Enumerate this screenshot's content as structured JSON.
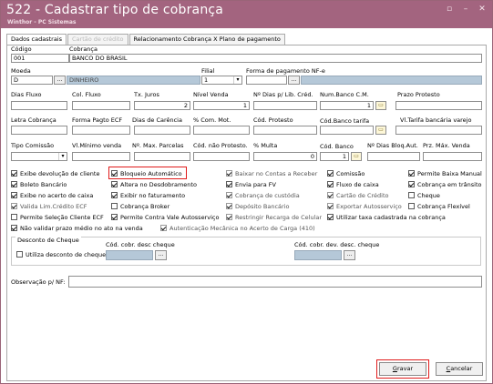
{
  "window": {
    "title": "522 - Cadastrar tipo de cobrança",
    "subtitle": "Winthor - PC Sistemas",
    "controls": {
      "minimize": "▫",
      "restore": "–",
      "close": "✕"
    }
  },
  "tabs": [
    {
      "label": "Dados cadastrais"
    },
    {
      "label": "Cartão de crédito"
    },
    {
      "label": "Relacionamento Cobrança X Plano de pagamento"
    }
  ],
  "fields": {
    "codigo": {
      "label": "Código",
      "value": "001"
    },
    "cobranca": {
      "label": "Cobrança",
      "value": "BANCO DO BRASIL"
    },
    "moeda": {
      "label": "Moeda",
      "value": "D",
      "dots": "...",
      "desc": "DINHEIRO"
    },
    "filial": {
      "label": "Filial",
      "value": "1"
    },
    "forma_pagamento": {
      "label": "Forma de pagamento NF-e",
      "dots": "..."
    },
    "dias_fluxo": {
      "label": "Dias Fluxo",
      "value": ""
    },
    "col_fluxo": {
      "label": "Col. Fluxo",
      "value": ""
    },
    "tx_juros": {
      "label": "Tx. Juros",
      "value": "2"
    },
    "nivel_venda": {
      "label": "Nível Venda",
      "value": "1"
    },
    "num_dias_lib": {
      "label": "Nº Dias p/ Lib. Créd.",
      "value": ""
    },
    "num_banco_cm": {
      "label": "Num.Banco C.M.",
      "value": "1"
    },
    "prazo_protesto": {
      "label": "Prazo Protesto",
      "value": ""
    },
    "letra_cobranca": {
      "label": "Letra Cobrança",
      "value": ""
    },
    "forma_pagto_ecf": {
      "label": "Forma Pagto ECF",
      "value": ""
    },
    "dias_carencia": {
      "label": "Dias de Carência",
      "value": ""
    },
    "com_mot": {
      "label": "% Com. Mot.",
      "value": ""
    },
    "cod_protesto": {
      "label": "Cód. Protesto",
      "value": ""
    },
    "cod_banco_tarifa": {
      "label": "Cód.Banco tarifa",
      "value": ""
    },
    "vl_tarifa": {
      "label": "Vl.Tarifa bancária varejo",
      "value": ""
    },
    "tipo_comissao": {
      "label": "Tipo Comissão",
      "value": ""
    },
    "vl_minimo_venda": {
      "label": "Vl.Mínimo venda",
      "value": ""
    },
    "max_parcelas": {
      "label": "Nº. Max. Parcelas",
      "value": ""
    },
    "cod_nao_protesto": {
      "label": "Cód. não Protesto.",
      "value": ""
    },
    "multa": {
      "label": "% Multa",
      "value": "0"
    },
    "cod_banco": {
      "label": "Cód. Banco",
      "value": "1"
    },
    "dias_bloq_aut": {
      "label": "Nº Dias Bloq.Aut.",
      "value": ""
    },
    "prz_max_venda": {
      "label": "Prz. Máx. Venda",
      "value": ""
    }
  },
  "checkboxes": [
    {
      "label": "Exibe devolução de cliente",
      "checked": true
    },
    {
      "label": "Bloqueio Automático",
      "checked": true
    },
    {
      "label": "Baixar no Contas a Receber",
      "checked": true
    },
    {
      "label": "Comissão",
      "checked": true
    },
    {
      "label": "Permite Baixa Manual",
      "checked": true
    },
    {
      "label": "Boleto Bancário",
      "checked": true
    },
    {
      "label": "Altera no Desdobramento",
      "checked": true
    },
    {
      "label": "Envia para FV",
      "checked": true
    },
    {
      "label": "Fluxo de caixa",
      "checked": true
    },
    {
      "label": "Cobrança em trânsito",
      "checked": true
    },
    {
      "label": "Exibe no acerto de caixa",
      "checked": true
    },
    {
      "label": "Exibir no faturamento",
      "checked": true
    },
    {
      "label": "Cobrança de custódia",
      "checked": true
    },
    {
      "label": "Cartão de Crédito",
      "checked": true
    },
    {
      "label": "Cheque",
      "checked": false
    },
    {
      "label": "Valida Lim.Crédito ECF",
      "checked": true
    },
    {
      "label": "Cobrança Broker",
      "checked": false
    },
    {
      "label": "Depósito Bancário",
      "checked": true
    },
    {
      "label": "Exportar Autosserviço",
      "checked": true
    },
    {
      "label": "Cobrança Flexível",
      "checked": false
    },
    {
      "label": "Permite Seleção Cliente ECF",
      "checked": false
    },
    {
      "label": "Permite Contra Vale Autosserviço",
      "checked": true
    },
    {
      "label": "Restringir Recarga de Celular",
      "checked": true
    },
    {
      "label": "Utilizar taxa cadastrada na cobrança",
      "checked": true
    },
    {
      "label": "Não validar prazo médio no ato na venda",
      "checked": true
    },
    {
      "label": "Autenticação Mecânica no Acerto de Carga (410)",
      "checked": true
    }
  ],
  "desconto": {
    "group_title": "Desconto de Cheque",
    "utiliza_label": "Utiliza desconto de cheque",
    "utiliza_checked": false,
    "cod_desc_label": "Cód. cobr. desc cheque",
    "cod_dev_desc_label": "Cód. cobr. dev. desc. cheque",
    "dots": "..."
  },
  "observacao": {
    "label": "Observação p/ NF:",
    "value": ""
  },
  "buttons": {
    "gravar_underline": "G",
    "gravar_rest": "ravar",
    "cancelar_underline": "C",
    "cancelar_rest": "ancelar"
  },
  "colors": {
    "titlebar": "#a3647f",
    "highlight": "#e01b1b",
    "readonly": "#b5c8d8"
  }
}
